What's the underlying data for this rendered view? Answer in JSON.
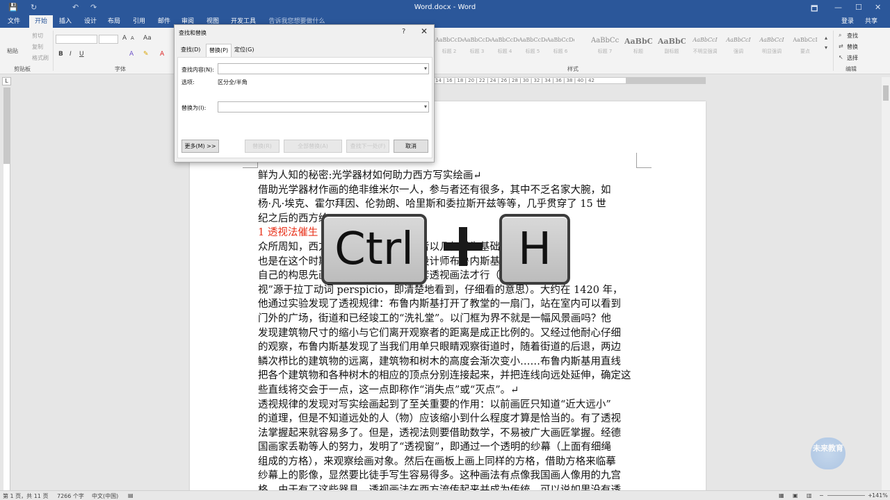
{
  "window": {
    "title": "Word.docx - Word",
    "min": "🗖",
    "restore": "—",
    "max": "☐",
    "close": "✕"
  },
  "qat": {
    "save": "💾",
    "undo": "↶",
    "redo": "↷",
    "repeat": "↻"
  },
  "ribbon_tabs": [
    "文件",
    "开始",
    "插入",
    "设计",
    "布局",
    "引用",
    "邮件",
    "审阅",
    "视图",
    "开发工具"
  ],
  "tell_me": "告诉我您想要做什么",
  "account": {
    "signin": "登录",
    "share": "共享"
  },
  "clipboard": {
    "paste": "粘贴",
    "cut": "剪切",
    "copy": "复制",
    "painter": "格式刷",
    "group": "剪贴板"
  },
  "font": {
    "group": "字体",
    "bold": "B",
    "italic": "I",
    "underline": "U",
    "grow": "A",
    "shrink": "A",
    "aa": "Aa"
  },
  "styles": {
    "group": "样式",
    "items": [
      {
        "preview": "AaBbCcDdEe",
        "name": "标题 2"
      },
      {
        "preview": "AaBbCcDdEe",
        "name": "标题 3"
      },
      {
        "preview": "AaBbCcDdEe",
        "name": "标题 4"
      },
      {
        "preview": "AaBbCcDdEe",
        "name": "标题 5"
      },
      {
        "preview": "AaBbCcDdEe",
        "name": "标题 6"
      },
      {
        "preview": "AaBbCcI",
        "name": "标题 7"
      },
      {
        "preview": "AaBbC",
        "name": "标题"
      },
      {
        "preview": "AaBbC",
        "name": "副标题"
      },
      {
        "preview": "AaBbCcI",
        "name": "不明显强调"
      },
      {
        "preview": "AaBbCcI",
        "name": "强调"
      },
      {
        "preview": "AaBbCcI",
        "name": "明显强调"
      },
      {
        "preview": "AaBbCcI",
        "name": "要点"
      }
    ]
  },
  "editing": {
    "find": "查找",
    "replace": "替换",
    "select": "选择",
    "group": "编辑"
  },
  "ruler": "14 | 16 | 18 | 20 | 22 | 24 | 26 | 28 | 30 | 32 | 34 | 36 | 38 | 40 | 42",
  "dialog": {
    "title": "查找和替换",
    "help": "?",
    "close": "✕",
    "tabs": [
      "查找(D)",
      "替换(P)",
      "定位(G)"
    ],
    "find_label": "查找内容(N):",
    "find_value": "",
    "options_label": "选项:",
    "options_value": "区分全/半角",
    "replace_label": "替换为(I):",
    "replace_value": "",
    "more": "更多(M) >>",
    "replace_btn": "替换(R)",
    "replace_all": "全部替换(A)",
    "find_next": "查找下一处(F)",
    "cancel": "取消"
  },
  "keys": {
    "ctrl": "Ctrl",
    "h": "H"
  },
  "doc": [
    {
      "text": "鲜为人知的秘密:光学器材如何助力西方写实绘画↵",
      "head": false
    },
    {
      "text": "借助光学器材作画的绝非维米尔一人，参与者还有很多，其中不乏名家大腕，如",
      "head": false
    },
    {
      "text": "杨·凡·埃克、霍尔拜因、伦勃朗、哈里斯和委拉斯开兹等等，几乎贯穿了 15 世",
      "head": false
    },
    {
      "text": "纪之后的西方绘",
      "head": false
    },
    {
      "text": "1 透视法催生",
      "head": true
    },
    {
      "text": "众所周知，西方文艺复兴时期，画作者以几何学为基础的透视法",
      "head": false
    },
    {
      "text": "也是在这个时期，佛罗伦萨大教堂总设计师布鲁内斯基觉得要把",
      "head": false
    },
    {
      "text": "自己的构思先画出来，必须要建立一套透视画法才行（“透",
      "head": false
    },
    {
      "text": "视”源于拉丁动词 perspicio，即清楚地看到，仔细看的意思）。大约在 1420 年，",
      "head": false
    },
    {
      "text": "他通过实验发现了透视规律：布鲁内斯基打开了教堂的一扇门，站在室内可以看到",
      "head": false
    },
    {
      "text": "门外的广场，街道和已经竣工的“洗礼堂”。以门框为界不就是一幅风景画吗？他",
      "head": false
    },
    {
      "text": "发现建筑物尺寸的缩小与它们离开观察者的距离是成正比例的。又经过他耐心仔细",
      "head": false
    },
    {
      "text": "的观察，布鲁内斯基发现了当我们用单只眼睛观察街道时，随着街道的后退，两边",
      "head": false
    },
    {
      "text": "鳞次栉比的建筑物的远离，建筑物和树木的高度会渐次变小……布鲁内斯基用直线",
      "head": false
    },
    {
      "text": "把各个建筑物和各种树木的相应的顶点分别连接起来，并把连线向远处延伸，确定这",
      "head": false
    },
    {
      "text": "些直线将交会于一点，这一点即称作“消失点”或“灭点”。↵",
      "head": false
    },
    {
      "text": "透视规律的发现对写实绘画起到了至关重要的作用：以前画匠只知道“近大远小”",
      "head": false
    },
    {
      "text": "的道理，但是不知道远处的人（物）应该缩小到什么程度才算是恰当的。有了透视",
      "head": false
    },
    {
      "text": "法掌握起来就容易多了。但是，透视法则要借助数学，不易被广大画匠掌握。经德",
      "head": false
    },
    {
      "text": "国画家丢勒等人的努力，发明了“透视窗”，即通过一个透明的纱幕（上面有细绳",
      "head": false
    },
    {
      "text": "组成的方格），来观察绘画对象。然后在画板上画上同样的方格，借助方格来临摹",
      "head": false
    },
    {
      "text": "纱幕上的影像，显然要比徒手写生容易得多。这种画法有点像我国画人像用的九宫",
      "head": false
    },
    {
      "text": "格。由于有了这些器具，透视画法在西方流传起来并成为传统，可以说如果没有透",
      "head": false
    }
  ],
  "status": {
    "page": "第 1 页，共 11 页",
    "words": "7266 个字",
    "lang": "中文(中国)",
    "zoom": "141%"
  },
  "watermark": "未来教育"
}
